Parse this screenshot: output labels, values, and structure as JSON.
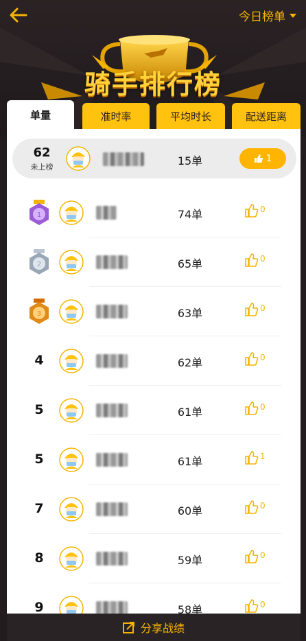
{
  "header": {
    "period_label": "今日榜单",
    "title": "骑手排行榜"
  },
  "tabs": [
    {
      "label": "单量",
      "active": true
    },
    {
      "label": "准时率",
      "active": false
    },
    {
      "label": "平均时长",
      "active": false
    },
    {
      "label": "配送距离",
      "active": false
    }
  ],
  "my_rank": {
    "rank": "62",
    "status": "未上榜",
    "count": "15单",
    "likes": "1"
  },
  "rows": [
    {
      "rank": "1",
      "medal": "gold-purple",
      "count": "74单",
      "likes": "0"
    },
    {
      "rank": "2",
      "medal": "silver",
      "count": "65单",
      "likes": "0"
    },
    {
      "rank": "3",
      "medal": "bronze",
      "count": "63单",
      "likes": "0"
    },
    {
      "rank": "4",
      "count": "62单",
      "likes": "0"
    },
    {
      "rank": "5",
      "count": "61单",
      "likes": "0"
    },
    {
      "rank": "5",
      "count": "61单",
      "likes": "1"
    },
    {
      "rank": "7",
      "count": "60单",
      "likes": "0"
    },
    {
      "rank": "8",
      "count": "59单",
      "likes": "0"
    },
    {
      "rank": "9",
      "count": "58单",
      "likes": "0"
    }
  ],
  "footer": {
    "share_label": "分享战绩"
  },
  "colors": {
    "accent": "#ffc20e",
    "accent_text": "#f5b400",
    "background": "#231c1e"
  }
}
